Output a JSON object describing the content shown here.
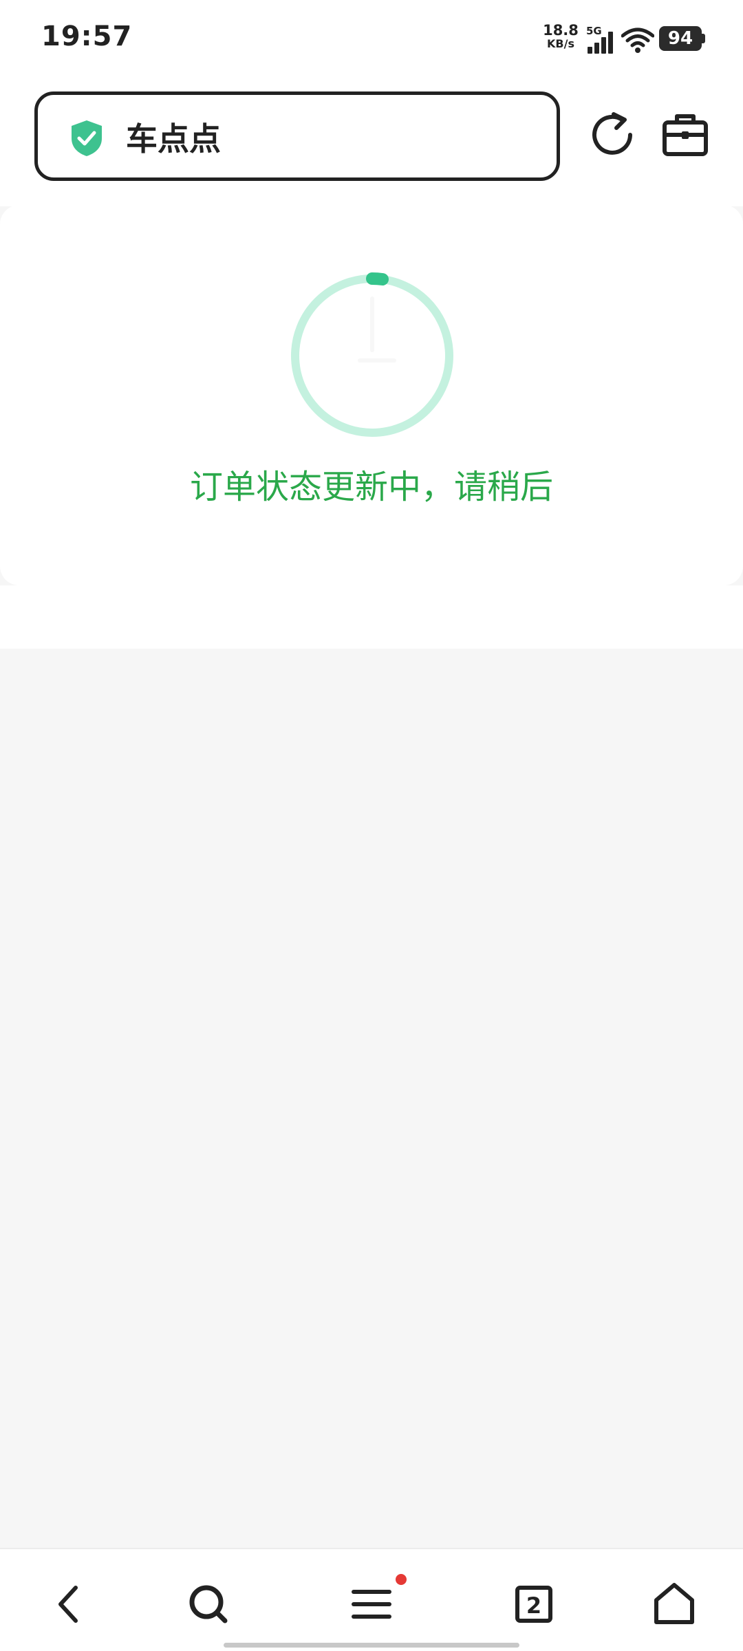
{
  "status_bar": {
    "time": "19:57",
    "net_speed_value": "18.8",
    "net_speed_unit": "KB/s",
    "network_type": "5G",
    "battery": "94"
  },
  "address_bar": {
    "title": "车点点",
    "secure_icon": "shield-check-icon"
  },
  "toolbar": {
    "refresh_icon": "refresh-icon",
    "toolbox_icon": "toolbox-icon"
  },
  "loading": {
    "message": "订单状态更新中，请稍后",
    "accent_color": "#2aa84a",
    "spinner_color": "#34c48b"
  },
  "bottom_nav": {
    "items": [
      {
        "icon": "back-icon"
      },
      {
        "icon": "search-icon"
      },
      {
        "icon": "menu-icon",
        "has_badge": true
      },
      {
        "icon": "tabs-icon",
        "count": "2"
      },
      {
        "icon": "home-icon"
      }
    ]
  }
}
